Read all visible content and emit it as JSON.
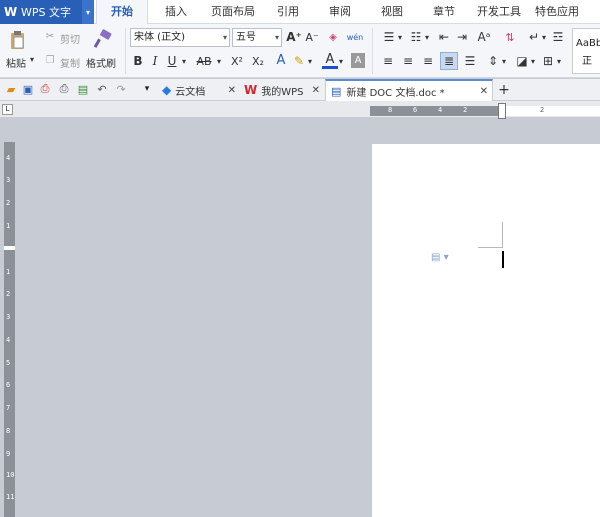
{
  "app": {
    "name": "WPS 文字",
    "dropdown": "▾"
  },
  "menu": [
    "开始",
    "插入",
    "页面布局",
    "引用",
    "审阅",
    "视图",
    "章节",
    "开发工具",
    "特色应用"
  ],
  "ribbon": {
    "paste_label": "粘贴",
    "cut_label": "剪切",
    "copy_label": "复制",
    "format_painter_label": "格式刷",
    "font_name": "宋体 (正文)",
    "font_size": "五号",
    "styles_preview_1": "AaBb",
    "styles_preview_2": "正"
  },
  "quick_access": {
    "more": "▾"
  },
  "doc_tabs": [
    {
      "label": "云文档"
    },
    {
      "label": "我的WPS"
    },
    {
      "label": "新建 DOC 文档.doc *"
    }
  ],
  "tab_add": "+",
  "ruler": {
    "h_numbers": [
      "8",
      "6",
      "4",
      "2",
      "2"
    ],
    "v_numbers": [
      "4",
      "3",
      "2",
      "1",
      "1",
      "2",
      "3",
      "4",
      "5",
      "6",
      "7",
      "8",
      "9",
      "10",
      "11"
    ]
  }
}
